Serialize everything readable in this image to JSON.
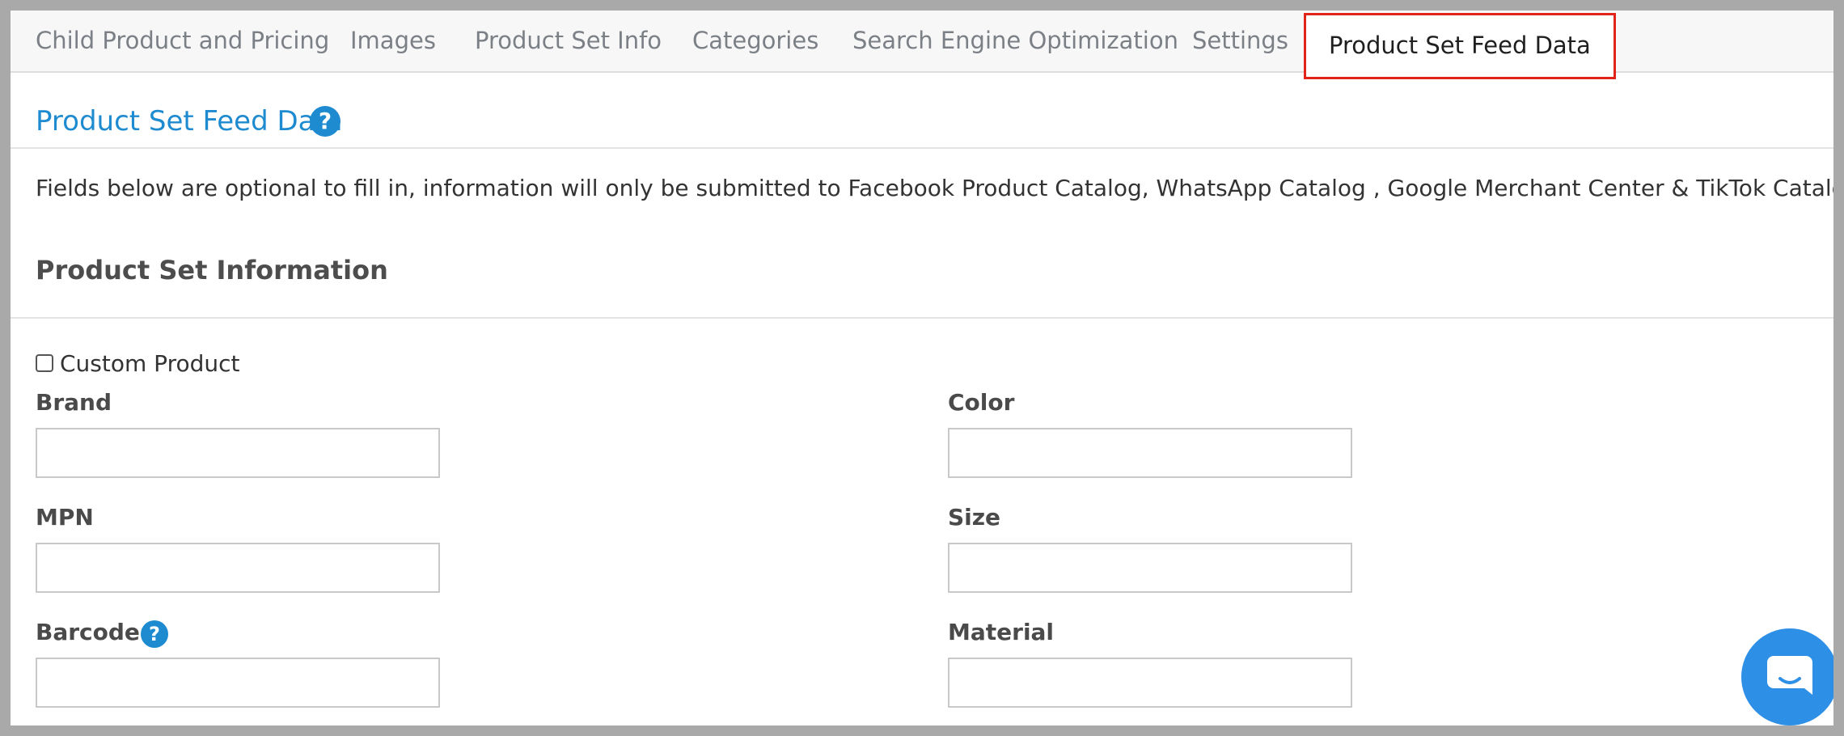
{
  "tabs": [
    {
      "label": "Child Product and Pricing"
    },
    {
      "label": "Images"
    },
    {
      "label": "Product Set Info"
    },
    {
      "label": "Categories"
    },
    {
      "label": "Search Engine Optimization"
    },
    {
      "label": "Settings"
    },
    {
      "label": "Product Set Feed Data",
      "active": true
    }
  ],
  "section": {
    "title": "Product Set Feed Data",
    "help_icon": "question-circle"
  },
  "intro_text": "Fields below are optional to fill in, information will only be submitted to Facebook Product Catalog, WhatsApp Catalog , Google Merchant Center & TikTok Catalog.",
  "subheader": "Product Set Information",
  "custom_product": {
    "label": "Custom Product",
    "checked": false
  },
  "fields": {
    "brand": {
      "label": "Brand",
      "value": ""
    },
    "color": {
      "label": "Color",
      "value": ""
    },
    "mpn": {
      "label": "MPN",
      "value": ""
    },
    "size": {
      "label": "Size",
      "value": ""
    },
    "barcode": {
      "label": "Barcode",
      "value": "",
      "help_icon": "question-circle"
    },
    "material": {
      "label": "Material",
      "value": ""
    }
  },
  "chat_widget": {
    "icon": "chat-bubble-icon"
  },
  "colors": {
    "accent_blue": "#1e8bd1",
    "active_tab_border": "#e2231a",
    "chat_button": "#2e8fe6"
  }
}
